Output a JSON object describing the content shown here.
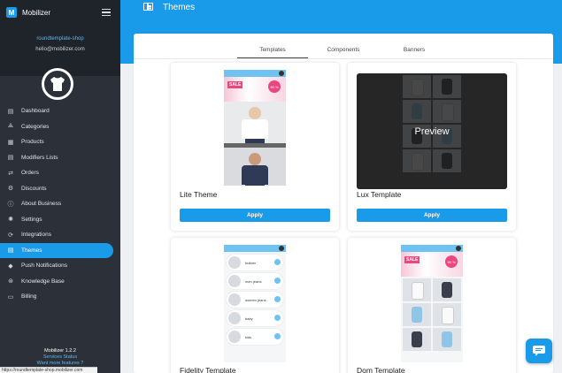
{
  "app": {
    "brand": "Mobilizer",
    "logo_letter": "M"
  },
  "profile": {
    "shop_name": "roundtemplate-shop",
    "email": "hello@mobilizer.com"
  },
  "menu": [
    {
      "label": "Dashboard",
      "icon": "dashboard-icon",
      "glyph": "▤"
    },
    {
      "label": "Categories",
      "icon": "categories-icon",
      "glyph": "⟁"
    },
    {
      "label": "Products",
      "icon": "products-icon",
      "glyph": "▦"
    },
    {
      "label": "Modifiers Lists",
      "icon": "modifiers-icon",
      "glyph": "▤"
    },
    {
      "label": "Orders",
      "icon": "orders-icon",
      "glyph": "⇄"
    },
    {
      "label": "Discounts",
      "icon": "discounts-icon",
      "glyph": "⚙"
    },
    {
      "label": "About Business",
      "icon": "info-icon",
      "glyph": "ⓘ"
    },
    {
      "label": "Settings",
      "icon": "gear-icon",
      "glyph": "✺"
    },
    {
      "label": "Integrations",
      "icon": "integrations-icon",
      "glyph": "⟳"
    },
    {
      "label": "Themes",
      "icon": "themes-icon",
      "glyph": "▤",
      "active": true
    },
    {
      "label": "Push Notifications",
      "icon": "bell-icon",
      "glyph": "◆"
    },
    {
      "label": "Knowledge Base",
      "icon": "knowledge-icon",
      "glyph": "⊛"
    },
    {
      "label": "Billing",
      "icon": "billing-icon",
      "glyph": "▭"
    }
  ],
  "footer": {
    "version": "Mobilizer 1.2.2",
    "services_status": "Services Status",
    "want_more": "Want more features ?",
    "status_url": "https://roundtemplate-shop.mobilizer.com"
  },
  "page": {
    "title": "Themes"
  },
  "tabs": [
    {
      "label": "Templates",
      "active": true
    },
    {
      "label": "Components",
      "active": false
    },
    {
      "label": "Banners",
      "active": false
    }
  ],
  "cards": [
    {
      "name": "Lite Theme",
      "apply": "Apply"
    },
    {
      "name": "Lux Template",
      "apply": "Apply",
      "overlay": "Preview"
    },
    {
      "name": "Fidelity Template"
    },
    {
      "name": "Dom Template"
    }
  ],
  "phone_text": {
    "sale": "SALE",
    "percent": "50 %",
    "list_items": [
      "builder",
      "men jeans",
      "women jeans",
      "baby",
      "kids"
    ]
  },
  "colors": {
    "accent": "#1a9be9",
    "sidebar": "#2c3038",
    "sidebar_dark": "#1f232a"
  }
}
